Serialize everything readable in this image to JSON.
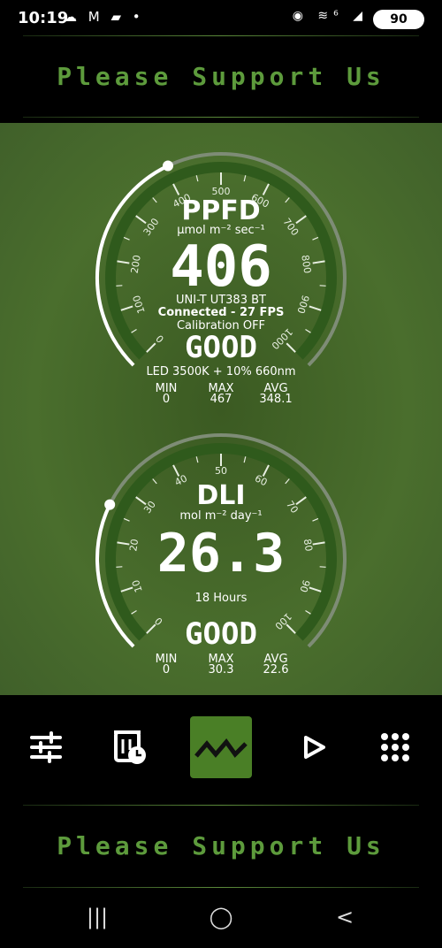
{
  "status_bar": {
    "time": "10:19",
    "left_icons": "☁ M ▰ •",
    "right_icons": "◉ ≋⁶ ◢",
    "battery": "90"
  },
  "banner_top": "Please Support Us",
  "banner_bottom": "Please Support Us",
  "ppfd": {
    "title": "PPFD",
    "unit": "µmol m⁻² sec⁻¹",
    "value": "406",
    "device": "UNI-T UT383 BT",
    "connection": "Connected - 27 FPS",
    "calibration": "Calibration OFF",
    "rating": "GOOD",
    "light_source": "LED 3500K + 10% 660nm",
    "gauge_max": 1000,
    "reading": 406,
    "scale_labels": [
      "0",
      "100",
      "200",
      "300",
      "400",
      "500",
      "600",
      "700",
      "800",
      "900",
      "1000"
    ],
    "stats": {
      "min_label": "MIN",
      "max_label": "MAX",
      "avg_label": "AVG",
      "min": "0",
      "max": "467",
      "avg": "348.1"
    }
  },
  "dli": {
    "title": "DLI",
    "unit": "mol m⁻² day⁻¹",
    "value": "26.3",
    "hours": "18 Hours",
    "rating": "GOOD",
    "gauge_max": 100,
    "reading": 26.3,
    "scale_labels": [
      "0",
      "10",
      "20",
      "30",
      "40",
      "50",
      "60",
      "70",
      "80",
      "90",
      "100"
    ],
    "stats": {
      "min_label": "MIN",
      "max_label": "MAX",
      "avg_label": "AVG",
      "min": "0",
      "max": "30.3",
      "avg": "22.6"
    }
  },
  "toolbar": {
    "items": [
      "sliders-icon",
      "timer-history-icon",
      "graph-icon",
      "play-icon",
      "grid-menu-icon"
    ],
    "active_color": "#4a7f26"
  },
  "colors": {
    "banner": "#5d9b3c",
    "gauge_band": "#2f5a1c",
    "panel": "#4a6e2d"
  }
}
